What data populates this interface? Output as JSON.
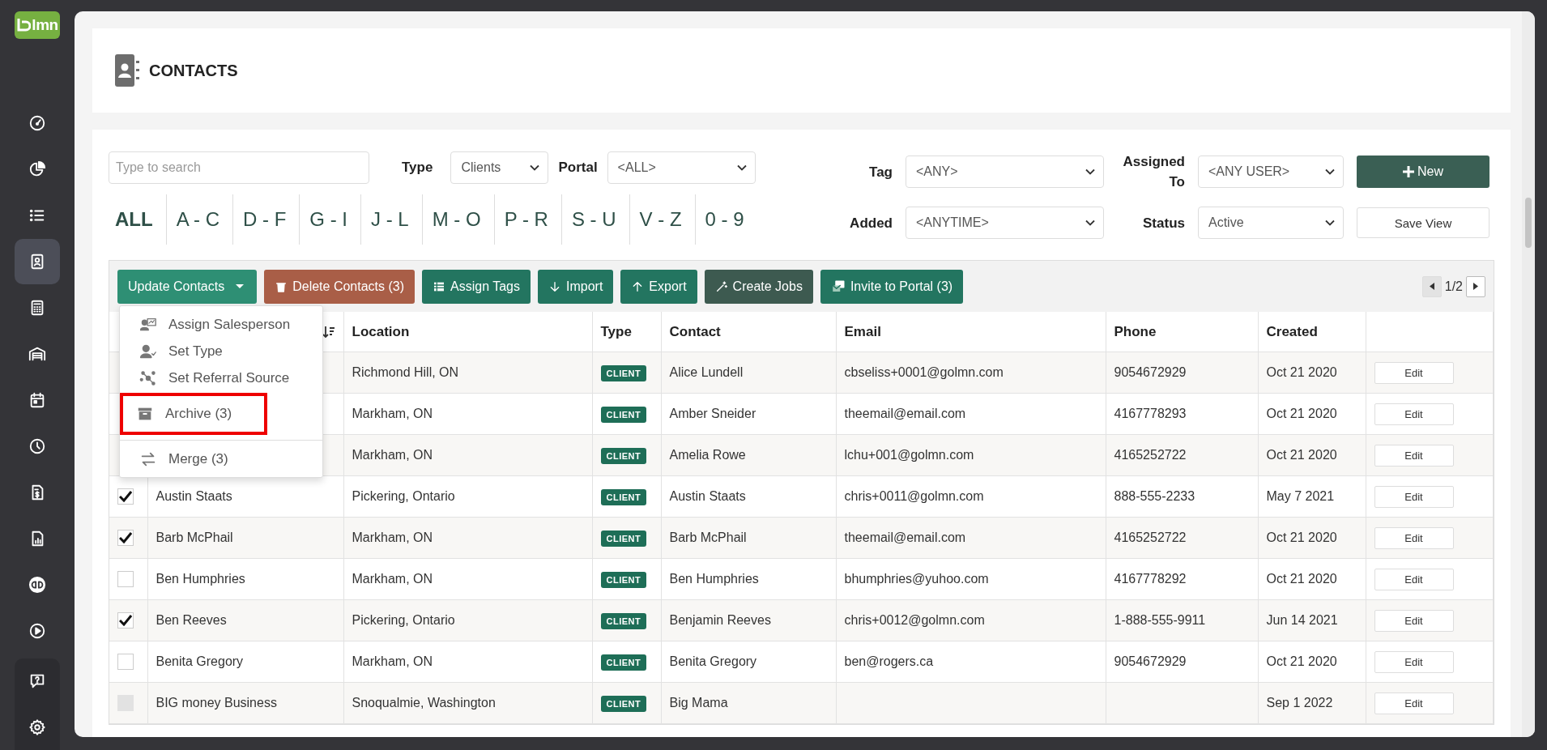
{
  "sidebar": {
    "logo": "lmn",
    "items": [
      {
        "kind": "gauge",
        "selected": false
      },
      {
        "kind": "pie",
        "selected": false
      },
      {
        "kind": "list",
        "selected": false
      },
      {
        "kind": "contact",
        "selected": true
      },
      {
        "kind": "calculator",
        "selected": false
      },
      {
        "kind": "garage",
        "selected": false
      },
      {
        "kind": "calendar",
        "selected": false
      },
      {
        "kind": "clock",
        "selected": false
      },
      {
        "kind": "invoice",
        "selected": false
      },
      {
        "kind": "report",
        "selected": false
      },
      {
        "kind": "qb",
        "selected": false
      },
      {
        "kind": "play",
        "selected": false
      }
    ],
    "footer_items": [
      {
        "kind": "help",
        "selected": false
      },
      {
        "kind": "settings",
        "selected": false
      }
    ]
  },
  "header": {
    "title": "CONTACTS"
  },
  "filters": {
    "search": {
      "placeholder": "Type to search"
    },
    "type": {
      "label": "Type",
      "value": "Clients"
    },
    "portal": {
      "label": "Portal",
      "value": "<ALL>"
    },
    "tag": {
      "label": "Tag",
      "value": "<ANY>"
    },
    "assigned": {
      "label": "Assigned To",
      "value": "<ANY USER>"
    },
    "added": {
      "label": "Added",
      "value": "<ANYTIME>"
    },
    "status": {
      "label": "Status",
      "value": "Active"
    },
    "new_button": "New",
    "save_button": "Save View",
    "letters": [
      {
        "label": "ALL",
        "selected": true
      },
      {
        "label": "A - C",
        "selected": false
      },
      {
        "label": "D - F",
        "selected": false
      },
      {
        "label": "G - I",
        "selected": false
      },
      {
        "label": "J - L",
        "selected": false
      },
      {
        "label": "M - O",
        "selected": false
      },
      {
        "label": "P - R",
        "selected": false
      },
      {
        "label": "S - U",
        "selected": false
      },
      {
        "label": "V - Z",
        "selected": false
      },
      {
        "label": "0 - 9",
        "selected": false
      }
    ]
  },
  "toolbar": {
    "buttons": [
      {
        "kind": "update",
        "label": "Update Contacts",
        "color": "#2e8f74"
      },
      {
        "kind": "delete",
        "label": "Delete Contacts (3)",
        "color": "#a95e47"
      },
      {
        "kind": "tags",
        "label": "Assign Tags",
        "color": "#237560"
      },
      {
        "kind": "import",
        "label": "Import",
        "color": "#237560"
      },
      {
        "kind": "export",
        "label": "Export",
        "color": "#237560"
      },
      {
        "kind": "jobs",
        "label": "Create Jobs",
        "color": "#3d5a50"
      },
      {
        "kind": "invite",
        "label": "Invite to Portal (3)",
        "color": "#237560"
      }
    ],
    "page": "1/2"
  },
  "menu": {
    "items": [
      {
        "kind": "salesperson",
        "label": "Assign Salesperson",
        "highlighted": false,
        "divider_before": false
      },
      {
        "kind": "type",
        "label": "Set Type",
        "highlighted": false,
        "divider_before": false
      },
      {
        "kind": "referral",
        "label": "Set Referral Source",
        "highlighted": false,
        "divider_before": false
      },
      {
        "kind": "archive",
        "label": "Archive (3)",
        "highlighted": true,
        "divider_before": false
      },
      {
        "kind": "merge",
        "label": "Merge (3)",
        "highlighted": false,
        "divider_before": true
      }
    ]
  },
  "table": {
    "columns": [
      "Location",
      "Type",
      "Contact",
      "Email",
      "Phone",
      "Created"
    ],
    "rows": [
      {
        "location": "Richmond Hill, ON",
        "type": "CLIENT",
        "contact": "Alice Lundell",
        "email": "cbseliss+0001@golmn.com",
        "phone": "9054672929",
        "created": "Oct 21 2020",
        "action": "Edit"
      },
      {
        "location": "Markham, ON",
        "type": "CLIENT",
        "contact": "Amber Sneider",
        "email": "theemail@email.com",
        "phone": "4167778293",
        "created": "Oct 21 2020",
        "action": "Edit"
      },
      {
        "location": "Markham, ON",
        "type": "CLIENT",
        "contact": "Amelia Rowe",
        "email": "lchu+001@golmn.com",
        "phone": "4165252722",
        "created": "Oct 21 2020",
        "action": "Edit"
      },
      {
        "name": "Austin Staats",
        "checked": true,
        "disabled": false,
        "location": "Pickering, Ontario",
        "type": "CLIENT",
        "contact": "Austin Staats",
        "email": "chris+0011@golmn.com",
        "phone": "888-555-2233",
        "created": "May 7 2021",
        "action": "Edit"
      },
      {
        "name": "Barb McPhail",
        "checked": true,
        "disabled": false,
        "location": "Markham, ON",
        "type": "CLIENT",
        "contact": "Barb McPhail",
        "email": "theemail@email.com",
        "phone": "4165252722",
        "created": "Oct 21 2020",
        "action": "Edit"
      },
      {
        "name": "Ben Humphries",
        "checked": false,
        "disabled": false,
        "location": "Markham, ON",
        "type": "CLIENT",
        "contact": "Ben Humphries",
        "email": "bhumphries@yuhoo.com",
        "phone": "4167778292",
        "created": "Oct 21 2020",
        "action": "Edit"
      },
      {
        "name": "Ben Reeves",
        "checked": true,
        "disabled": false,
        "location": "Pickering, Ontario",
        "type": "CLIENT",
        "contact": "Benjamin Reeves",
        "email": "chris+0012@golmn.com",
        "phone": "1-888-555-9911",
        "created": "Jun 14 2021",
        "action": "Edit"
      },
      {
        "name": "Benita Gregory",
        "checked": false,
        "disabled": false,
        "location": "Markham, ON",
        "type": "CLIENT",
        "contact": "Benita Gregory",
        "email": "ben@rogers.ca",
        "phone": "9054672929",
        "created": "Oct 21 2020",
        "action": "Edit"
      },
      {
        "name": "BIG money Business",
        "checked": false,
        "disabled": true,
        "location": "Snoqualmie, Washington",
        "type": "CLIENT",
        "contact": "Big Mama",
        "created": "Sep 1 2022",
        "action": "Edit"
      }
    ]
  }
}
